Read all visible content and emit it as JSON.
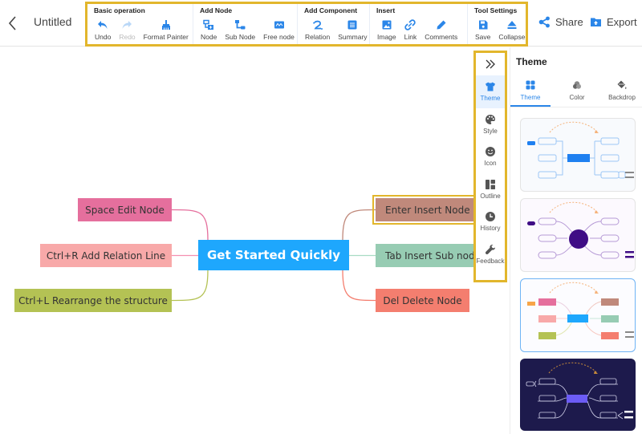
{
  "header": {
    "title": "Untitled",
    "share_label": "Share",
    "export_label": "Export"
  },
  "toolbar": {
    "groups": [
      {
        "title": "Basic operation",
        "tools": [
          {
            "label": "Undo",
            "icon": "undo-icon",
            "enabled": true
          },
          {
            "label": "Redo",
            "icon": "redo-icon",
            "enabled": false
          },
          {
            "label": "Format Painter",
            "icon": "format-painter-icon",
            "enabled": true
          }
        ]
      },
      {
        "title": "Add Node",
        "tools": [
          {
            "label": "Node",
            "icon": "node-icon",
            "enabled": true
          },
          {
            "label": "Sub Node",
            "icon": "sub-node-icon",
            "enabled": true
          },
          {
            "label": "Free node",
            "icon": "free-node-icon",
            "enabled": true
          }
        ]
      },
      {
        "title": "Add Component",
        "tools": [
          {
            "label": "Relation",
            "icon": "relation-icon",
            "enabled": true
          },
          {
            "label": "Summary",
            "icon": "summary-icon",
            "enabled": true
          }
        ]
      },
      {
        "title": "Insert",
        "tools": [
          {
            "label": "Image",
            "icon": "image-icon",
            "enabled": true
          },
          {
            "label": "Link",
            "icon": "link-icon",
            "enabled": true
          },
          {
            "label": "Comments",
            "icon": "comments-icon",
            "enabled": true
          }
        ]
      },
      {
        "title": "Tool Settings",
        "tools": [
          {
            "label": "Save",
            "icon": "save-icon",
            "enabled": true
          },
          {
            "label": "Collapse",
            "icon": "collapse-icon",
            "enabled": true
          }
        ]
      }
    ]
  },
  "mindmap": {
    "root": {
      "text": "Get Started Quickly",
      "color": "#1ea7fd"
    },
    "left": [
      {
        "text": "Space Edit Node",
        "color": "#e56f9d",
        "line": "#e56f9d"
      },
      {
        "text": "Ctrl+R Add Relation Line",
        "color": "#f8a9a9",
        "line": "#f48fb1"
      },
      {
        "text": "Ctrl+L Rearrange the structure",
        "color": "#b4c254",
        "line": "#b4c254"
      }
    ],
    "right": [
      {
        "text": "Enter Insert Node",
        "color": "#c0897b",
        "line": "#c0897b",
        "selected": true
      },
      {
        "text": "Tab Insert Sub node",
        "color": "#97ccb3",
        "line": "#a8dcc4"
      },
      {
        "text": "Del Delete Node",
        "color": "#f47e6f",
        "line": "#f47e6f"
      }
    ]
  },
  "side_tabs": {
    "collapse_label": ">>",
    "items": [
      {
        "label": "Theme",
        "icon": "tshirt-icon",
        "active": true
      },
      {
        "label": "Style",
        "icon": "palette-icon",
        "active": false
      },
      {
        "label": "Icon",
        "icon": "smiley-icon",
        "active": false
      },
      {
        "label": "Outline",
        "icon": "outline-icon",
        "active": false
      },
      {
        "label": "History",
        "icon": "clock-icon",
        "active": false
      },
      {
        "label": "Feedback",
        "icon": "wrench-icon",
        "active": false
      }
    ]
  },
  "panel": {
    "title": "Theme",
    "sub_tabs": [
      {
        "label": "Theme",
        "icon": "grid-icon",
        "active": true
      },
      {
        "label": "Color",
        "icon": "color-icon",
        "active": false
      },
      {
        "label": "Backdrop",
        "icon": "paint-bucket-icon",
        "active": false
      }
    ],
    "themes": [
      {
        "name": "blue-classic",
        "selected": false
      },
      {
        "name": "purple-circle",
        "selected": false
      },
      {
        "name": "colorful",
        "selected": true
      },
      {
        "name": "dark-navy",
        "selected": false
      }
    ]
  },
  "colors": {
    "accent": "#2b86e8",
    "highlight_border": "#e2b62c",
    "root_node": "#1ea7fd"
  }
}
